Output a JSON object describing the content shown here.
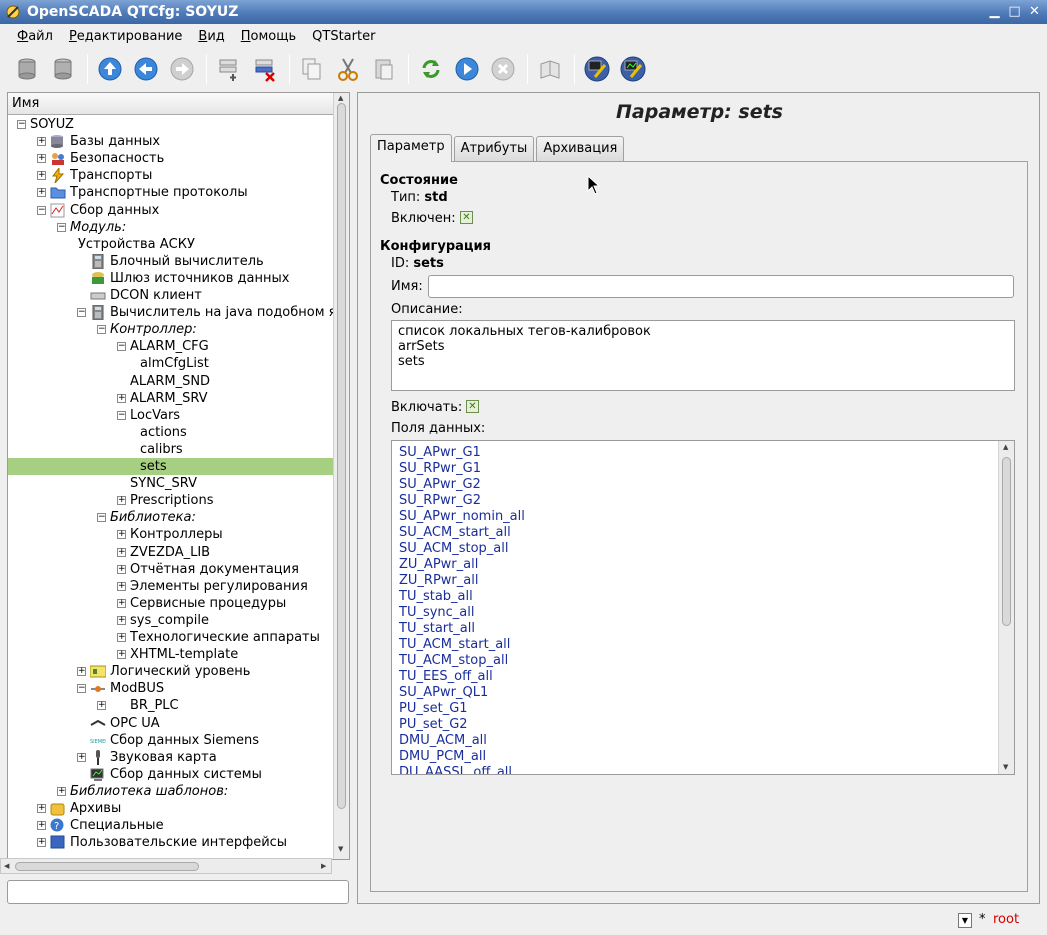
{
  "window": {
    "title": "OpenSCADA QTCfg: SOYUZ"
  },
  "menu": [
    {
      "label": "Файл",
      "u": "Ф",
      "rest": "айл"
    },
    {
      "label": "Редактирование",
      "u": "Р",
      "rest": "едактирование"
    },
    {
      "label": "Вид",
      "u": "В",
      "rest": "ид"
    },
    {
      "label": "Помощь",
      "u": "П",
      "rest": "омощь"
    },
    {
      "label": "QTStarter",
      "u": "",
      "rest": "QTStarter"
    }
  ],
  "toolbar_icons": [
    "db-load-icon",
    "db-save-icon",
    "up-icon",
    "back-icon",
    "forward-icon",
    "add-item-icon",
    "delete-item-icon",
    "copy-icon",
    "cut-icon",
    "paste-icon",
    "refresh-icon",
    "start-icon",
    "stop-icon",
    "manual-icon",
    "uiprog-icon",
    "graph-icon"
  ],
  "tree": {
    "header": "Имя",
    "items": [
      {
        "label": "SOYUZ",
        "level": 0,
        "exp": "minus",
        "icon": ""
      },
      {
        "label": "Базы данных",
        "level": 1,
        "exp": "plus",
        "icon": "db"
      },
      {
        "label": "Безопасность",
        "level": 1,
        "exp": "plus",
        "icon": "security"
      },
      {
        "label": "Транспорты",
        "level": 1,
        "exp": "plus",
        "icon": "transport"
      },
      {
        "label": "Транспортные протоколы",
        "level": 1,
        "exp": "plus",
        "icon": "folder"
      },
      {
        "label": "Сбор данных",
        "level": 1,
        "exp": "minus",
        "icon": "daq"
      },
      {
        "label": "Модуль:",
        "level": 2,
        "exp": "minus",
        "icon": "",
        "italic": true
      },
      {
        "label": "Устройства АСКУ",
        "level": 3,
        "exp": "",
        "icon": "",
        "nofix": true
      },
      {
        "label": "Блочный вычислитель",
        "level": 3,
        "exp": "",
        "icon": "calc"
      },
      {
        "label": "Шлюз источников данных",
        "level": 3,
        "exp": "",
        "icon": "gate"
      },
      {
        "label": "DCON клиент",
        "level": 3,
        "exp": "",
        "icon": "dcon"
      },
      {
        "label": "Вычислитель на java подобном язы",
        "level": 3,
        "exp": "minus",
        "icon": "calc"
      },
      {
        "label": "Контроллер:",
        "level": 4,
        "exp": "minus",
        "icon": "",
        "italic": true
      },
      {
        "label": "ALARM_CFG",
        "level": 5,
        "exp": "minus",
        "icon": ""
      },
      {
        "label": "almCfgList",
        "level": 6,
        "exp": "",
        "icon": ""
      },
      {
        "label": "ALARM_SND",
        "level": 5,
        "exp": "",
        "icon": ""
      },
      {
        "label": "ALARM_SRV",
        "level": 5,
        "exp": "plus",
        "icon": ""
      },
      {
        "label": "LocVars",
        "level": 5,
        "exp": "minus",
        "icon": ""
      },
      {
        "label": "actions",
        "level": 6,
        "exp": "",
        "icon": ""
      },
      {
        "label": "calibrs",
        "level": 6,
        "exp": "",
        "icon": ""
      },
      {
        "label": "sets",
        "level": 6,
        "exp": "",
        "icon": "",
        "selected": true
      },
      {
        "label": "SYNC_SRV",
        "level": 5,
        "exp": "",
        "icon": ""
      },
      {
        "label": "Prescriptions",
        "level": 5,
        "exp": "plus",
        "icon": ""
      },
      {
        "label": "Библиотека:",
        "level": 4,
        "exp": "minus",
        "icon": "",
        "italic": true
      },
      {
        "label": "Контроллеры",
        "level": 5,
        "exp": "plus",
        "icon": ""
      },
      {
        "label": "ZVEZDA_LIB",
        "level": 5,
        "exp": "plus",
        "icon": ""
      },
      {
        "label": "Отчётная документация",
        "level": 5,
        "exp": "plus",
        "icon": ""
      },
      {
        "label": "Элементы регулирования",
        "level": 5,
        "exp": "plus",
        "icon": ""
      },
      {
        "label": "Сервисные процедуры",
        "level": 5,
        "exp": "plus",
        "icon": ""
      },
      {
        "label": "sys_compile",
        "level": 5,
        "exp": "plus",
        "icon": ""
      },
      {
        "label": "Технологические аппараты",
        "level": 5,
        "exp": "plus",
        "icon": ""
      },
      {
        "label": "XHTML-template",
        "level": 5,
        "exp": "plus",
        "icon": ""
      },
      {
        "label": "Логический уровень",
        "level": 3,
        "exp": "plus",
        "icon": "logic"
      },
      {
        "label": "ModBUS",
        "level": 3,
        "exp": "minus",
        "icon": "modbus"
      },
      {
        "label": "BR_PLC",
        "level": 4,
        "exp": "plus",
        "icon": ""
      },
      {
        "label": "OPC UA",
        "level": 3,
        "exp": "",
        "icon": "opc"
      },
      {
        "label": "Сбор данных Siemens",
        "level": 3,
        "exp": "",
        "icon": "siemens"
      },
      {
        "label": "Звуковая карта",
        "level": 3,
        "exp": "plus",
        "icon": "mic"
      },
      {
        "label": "Сбор данных системы",
        "level": 3,
        "exp": "",
        "icon": "system"
      },
      {
        "label": "Библиотека шаблонов:",
        "level": 2,
        "exp": "plus",
        "icon": "",
        "italic": true
      },
      {
        "label": "Архивы",
        "level": 1,
        "exp": "plus",
        "icon": "archive"
      },
      {
        "label": "Специальные",
        "level": 1,
        "exp": "plus",
        "icon": "special"
      },
      {
        "label": "Пользовательские интерфейсы",
        "level": 1,
        "exp": "plus",
        "icon": "ui"
      }
    ]
  },
  "panel": {
    "title": "Параметр: sets",
    "tabs": [
      "Параметр",
      "Атрибуты",
      "Архивация"
    ],
    "state_header": "Состояние",
    "type_label": "Тип:",
    "type_value": "std",
    "enabled_label": "Включен:",
    "config_header": "Конфигурация",
    "id_label": "ID:",
    "id_value": "sets",
    "name_label": "Имя:",
    "name_value": "",
    "desc_label": "Описание:",
    "desc_lines": [
      "список локальных тегов-калибровок",
      "arrSets",
      "sets"
    ],
    "enable_label": "Включать:",
    "fields_label": "Поля данных:",
    "fields": [
      "SU_APwr_G1",
      "SU_RPwr_G1",
      "SU_APwr_G2",
      "SU_RPwr_G2",
      "SU_APwr_nomin_all",
      "SU_ACM_start_all",
      "SU_ACM_stop_all",
      "ZU_APwr_all",
      "ZU_RPwr_all",
      "TU_stab_all",
      "TU_sync_all",
      "TU_start_all",
      "TU_ACM_start_all",
      "TU_ACM_stop_all",
      "TU_EES_off_all",
      "SU_APwr_QL1",
      "PU_set_G1",
      "PU_set_G2",
      "DMU_ACM_all",
      "DMU_PCM_all",
      "DU_AASSL_off_all"
    ]
  },
  "status": {
    "star": "*",
    "user": "root"
  }
}
